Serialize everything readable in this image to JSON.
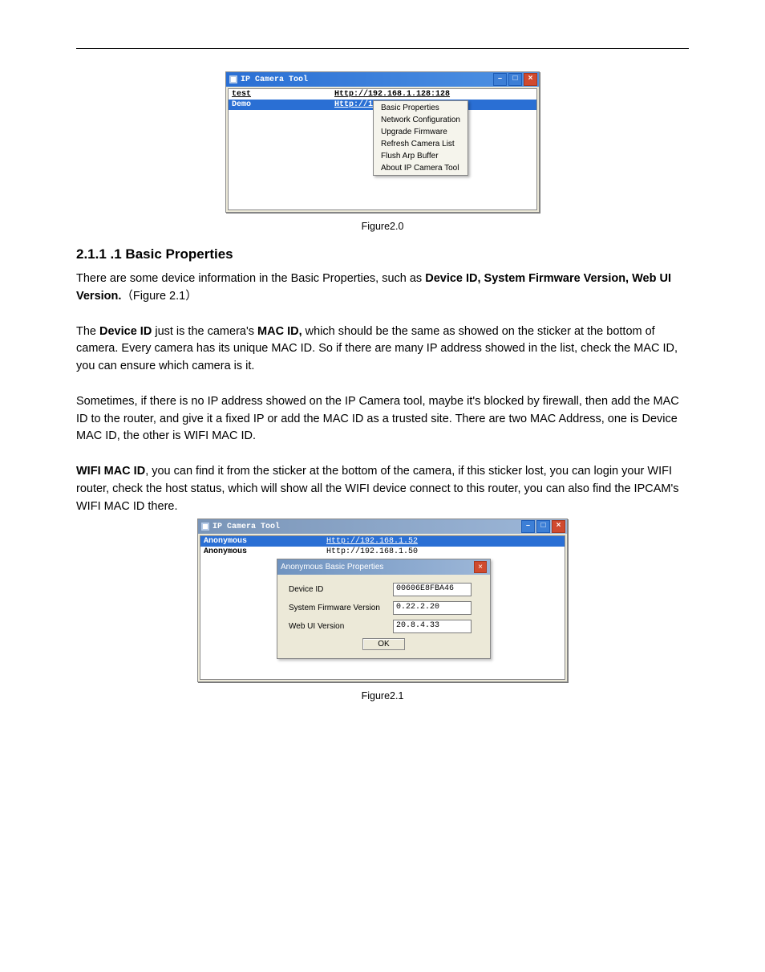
{
  "figure1": {
    "window_title": "IP Camera Tool",
    "rows": [
      {
        "name": "test",
        "url": "Http://192.168.1.128:128"
      },
      {
        "name": "Demo",
        "url": "Http://192"
      }
    ],
    "context_menu": [
      "Basic Properties",
      "Network Configuration",
      "Upgrade Firmware",
      "Refresh Camera List",
      "Flush Arp Buffer",
      "About IP Camera Tool"
    ],
    "caption": "Figure2.0"
  },
  "section": {
    "heading": "2.1.1 .1 Basic Properties",
    "p1_a": "There are some device information in the Basic Properties, such as ",
    "p1_b": "Device ID, System Firmware Version, Web UI Version.",
    "p1_c": "（Figure 2.1）",
    "p2_a": "The ",
    "p2_b": "Device ID",
    "p2_c": " just is the camera's ",
    "p2_d": "MAC ID,",
    "p2_e": " which should be the same as showed on the sticker at the bottom of camera. Every camera has its unique MAC ID. So if there are many IP address showed in the list, check the MAC ID, you can ensure which camera is it.",
    "p3": "Sometimes, if there is no IP address showed on the IP Camera tool, maybe it's blocked by firewall, then add the MAC ID to the router, and give it a fixed IP or add the MAC ID as a trusted site. There are two MAC Address, one is Device MAC ID, the other is WIFI MAC ID.",
    "p4_a": "WIFI MAC ID",
    "p4_b": ", you can find it from the sticker at the bottom of the camera, if this sticker lost, you can login your WIFI router, check the host status, which will show all the WIFI device connect to this router, you can also find the IPCAM's WIFI MAC ID there."
  },
  "figure2": {
    "window_title": "IP Camera Tool",
    "rows": [
      {
        "name": "Anonymous",
        "url": "Http://192.168.1.52"
      },
      {
        "name": "Anonymous",
        "url": "Http://192.168.1.50"
      }
    ],
    "dialog": {
      "title": "Anonymous Basic Properties",
      "fields": {
        "device_id_label": "Device ID",
        "device_id_value": "00606E8FBA46",
        "firmware_label": "System Firmware Version",
        "firmware_value": "0.22.2.20",
        "webui_label": "Web UI Version",
        "webui_value": "20.8.4.33"
      },
      "ok": "OK"
    },
    "caption": "Figure2.1"
  },
  "winbtn": {
    "min": "–",
    "max": "□",
    "close": "×"
  }
}
